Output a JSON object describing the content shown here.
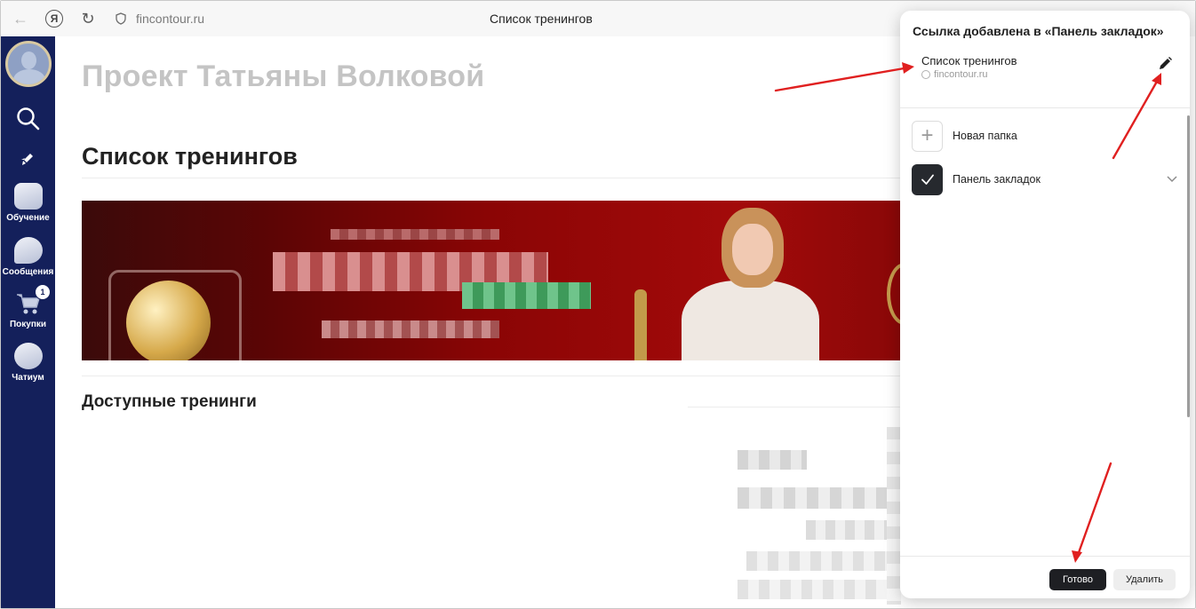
{
  "browser": {
    "url": "fincontour.ru",
    "tab_title": "Список тренингов"
  },
  "sidebar": {
    "items": [
      {
        "label": "Обучение",
        "icon": "graduation-icon"
      },
      {
        "label": "Сообщения",
        "icon": "message-icon"
      },
      {
        "label": "Покупки",
        "icon": "cart-icon",
        "badge": "1"
      },
      {
        "label": "Чатиум",
        "icon": "chat-icon"
      }
    ]
  },
  "main": {
    "project_title": "Проект Татьяны Волковой",
    "page_title": "Список тренингов",
    "section_title": "Доступные тренинги"
  },
  "bookmark_popup": {
    "header": "Ссылка добавлена в «Панель закладок»",
    "bookmark_name": "Список тренингов",
    "bookmark_domain": "fincontour.ru",
    "folders": [
      {
        "label": "Новая папка",
        "icon": "plus-icon",
        "selected": false
      },
      {
        "label": "Панель закладок",
        "icon": "checkmark-icon",
        "selected": true
      }
    ],
    "done_label": "Готово",
    "delete_label": "Удалить"
  },
  "colors": {
    "sidebar_bg": "#14205b",
    "annotation_arrow": "#e02020",
    "done_button": "#1e1f23"
  }
}
